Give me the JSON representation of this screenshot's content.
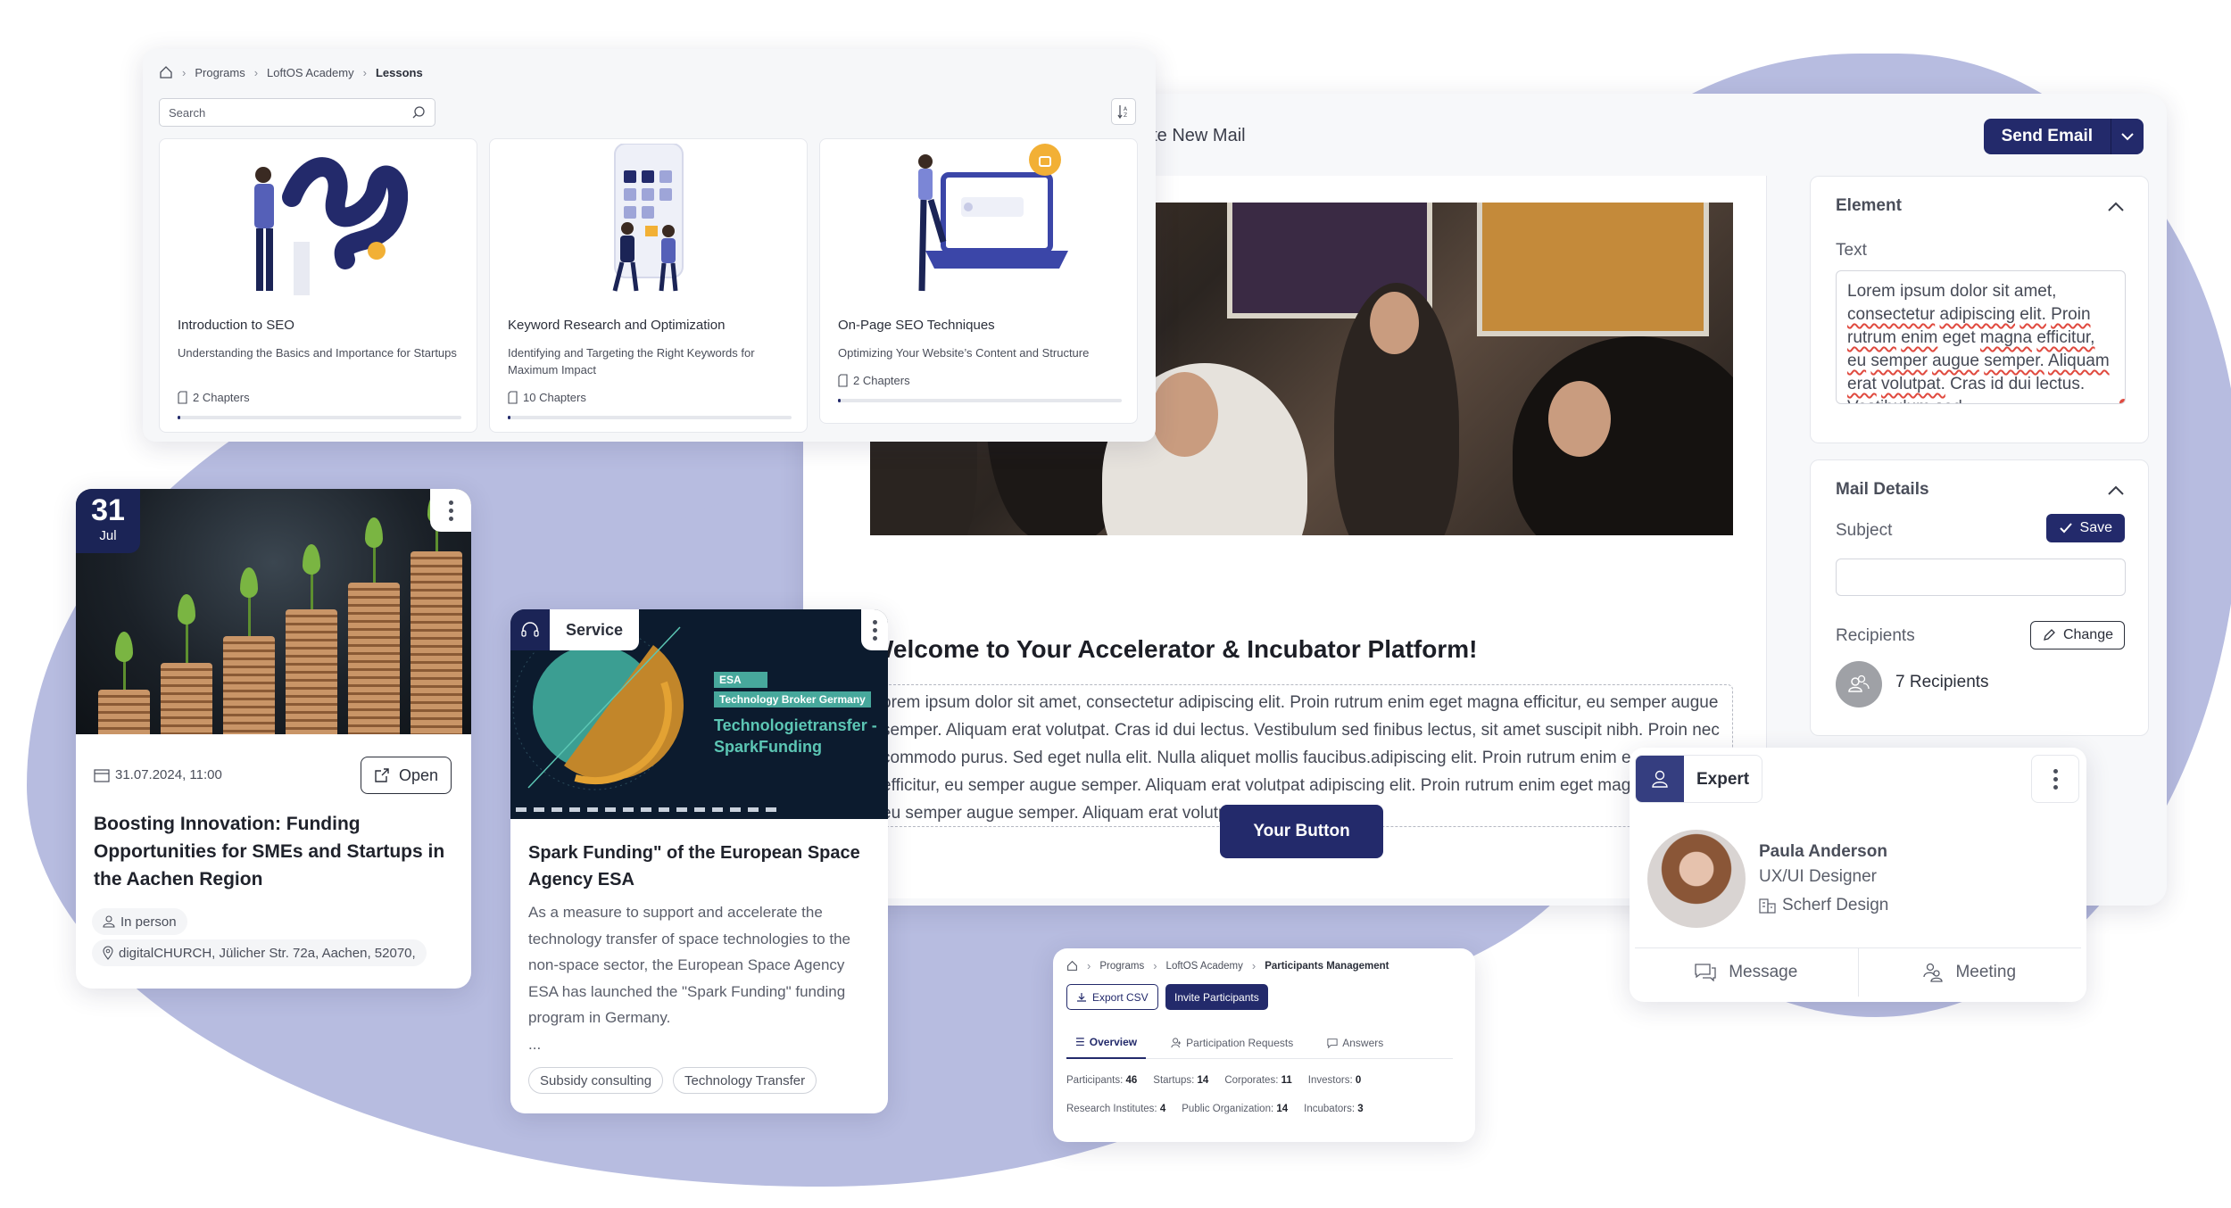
{
  "colors": {
    "brand_navy": "#232a6b",
    "background_blob": "#b7bce0",
    "spellcheck_red": "#e04a3f",
    "esa_teal": "#47a89c"
  },
  "lessons_panel": {
    "breadcrumb": [
      "Programs",
      "LoftOS Academy",
      "Lessons"
    ],
    "search": {
      "placeholder": "Search",
      "value": ""
    },
    "sort_icon": "sort-az-icon",
    "lessons": [
      {
        "title": "Introduction to SEO",
        "description": "Understanding the Basics and Importance for Startups",
        "chapters": "2 Chapters",
        "progress_percent": 1
      },
      {
        "title": "Keyword Research and Optimization",
        "description": "Identifying and Targeting the Right Keywords for Maximum Impact",
        "chapters": "10 Chapters",
        "progress_percent": 1
      },
      {
        "title": "On-Page SEO Techniques",
        "description": "Optimizing Your Website’s Content and Structure",
        "chapters": "2 Chapters",
        "progress_percent": 1
      }
    ]
  },
  "mail_editor": {
    "title": "ate New Mail",
    "send_button": "Send Email",
    "headline": "Welcome to Your Accelerator & Incubator Platform!",
    "body_text": "orem ipsum dolor sit amet, consectetur adipiscing elit. Proin rutrum enim eget magna efficitur, eu semper augue semper. Aliquam erat volutpat. Cras id dui lectus. Vestibulum sed finibus lectus, sit amet suscipit nibh. Proin nec commodo purus. Sed eget nulla elit. Nulla aliquet mollis faucibus.adipiscing elit. Proin rutrum enim eget magna efficitur, eu semper augue semper. Aliquam erat volutpat adipiscing elit. Proin rutrum enim eget magna efficitur, eu semper augue semper. Aliquam erat volutpat",
    "cta_button": "Your Button",
    "element_panel": {
      "heading": "Element",
      "text_label": "Text",
      "text_words": [
        {
          "w": "Lorem ipsum dolor sit amet,",
          "sp": false
        },
        {
          "w": "consectetur",
          "sp": true
        },
        {
          "w": "adipiscing",
          "sp": true
        },
        {
          "w": "elit.",
          "sp": true
        },
        {
          "w": "Proin",
          "sp": true
        },
        {
          "w": "rutrum",
          "sp": true
        },
        {
          "w": "enim",
          "sp": true
        },
        {
          "w": "eget",
          "sp": false
        },
        {
          "w": "magna",
          "sp": true
        },
        {
          "w": "efficitur,",
          "sp": true
        },
        {
          "w": "eu",
          "sp": true
        },
        {
          "w": "semper",
          "sp": true
        },
        {
          "w": "augue",
          "sp": true
        },
        {
          "w": "semper.",
          "sp": true
        },
        {
          "w": "Aliquam",
          "sp": true
        },
        {
          "w": "erat",
          "sp": true
        },
        {
          "w": "volutpat.",
          "sp": true
        },
        {
          "w": "Cras id dui lectus. Vestibulum sed",
          "sp": false
        }
      ]
    },
    "mail_details": {
      "heading": "Mail Details",
      "subject_label": "Subject",
      "subject_value": "",
      "save_button": "Save",
      "recipients_label": "Recipients",
      "change_button": "Change",
      "recipients_count": "7 Recipients"
    }
  },
  "event_card": {
    "day": "31",
    "month": "Jul",
    "datetime": "31.07.2024, 11:00",
    "open_button": "Open",
    "title": "Boosting Innovation: Funding Opportunities for SMEs and Startups in the Aachen Region",
    "mode": "In person",
    "location": "digitalCHURCH, Jülicher Str. 72a, Aachen, 52070,"
  },
  "service_card": {
    "tag": "Service",
    "image_labels": {
      "esa": "ESA",
      "broker": "Technology Broker Germany",
      "headline_1": "Technologietransfer -",
      "headline_2": "SparkFunding"
    },
    "title": "Spark Funding\" of the European Space Agency ESA",
    "description": "As a measure to support and accelerate the technology transfer of space technologies to the non-space sector, the European Space Agency ESA has launched the \"Spark Funding\" funding program in Germany.",
    "ellipsis": "...",
    "tags": [
      "Subsidy consulting",
      "Technology Transfer"
    ]
  },
  "participants_card": {
    "breadcrumb": [
      "Programs",
      "LoftOS Academy",
      "Participants Management"
    ],
    "export_button": "Export CSV",
    "invite_button": "Invite Participants",
    "tabs": [
      {
        "label": "Overview",
        "icon": "list-icon",
        "active": true
      },
      {
        "label": "Participation Requests",
        "icon": "user-plus-icon",
        "active": false
      },
      {
        "label": "Answers",
        "icon": "comment-icon",
        "active": false
      }
    ],
    "stats_row1": [
      {
        "label": "Participants:",
        "value": "46"
      },
      {
        "label": "Startups:",
        "value": "14"
      },
      {
        "label": "Corporates:",
        "value": "11"
      },
      {
        "label": "Investors:",
        "value": "0"
      }
    ],
    "stats_row2": [
      {
        "label": "Research Institutes:",
        "value": "4"
      },
      {
        "label": "Public Organization:",
        "value": "14"
      },
      {
        "label": "Incubators:",
        "value": "3"
      }
    ]
  },
  "expert_card": {
    "tag": "Expert",
    "name": "Paula Anderson",
    "role": "UX/UI Designer",
    "company": "Scherf Design",
    "message_button": "Message",
    "meeting_button": "Meeting"
  }
}
